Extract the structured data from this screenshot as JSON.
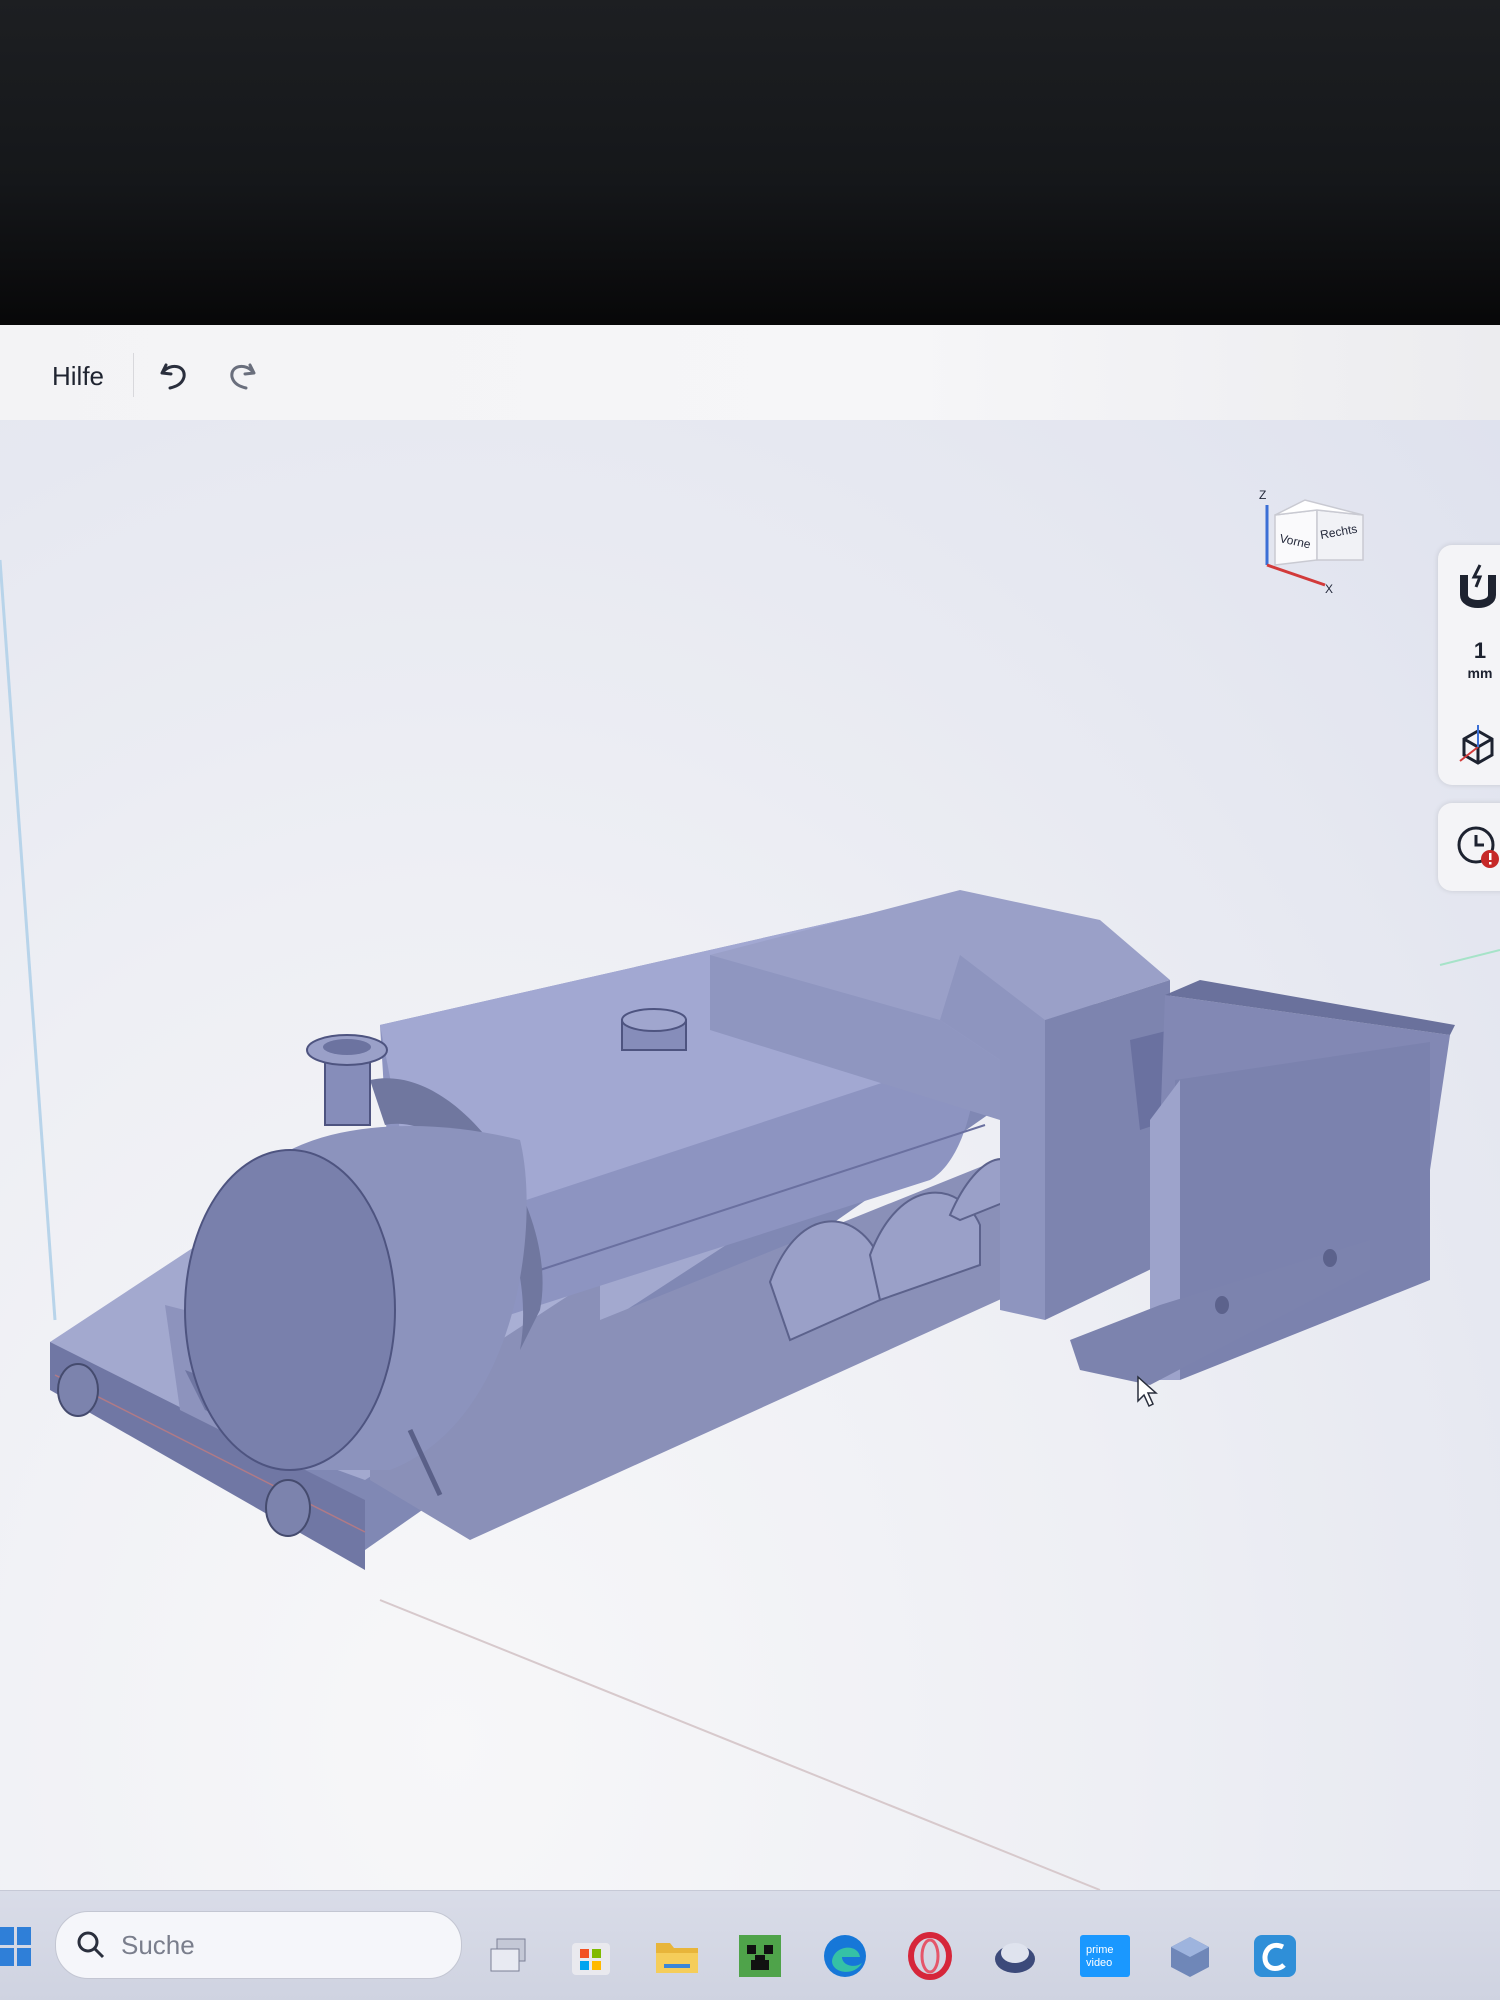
{
  "menubar": {
    "help_label": "Hilfe",
    "undo_icon": "undo-icon",
    "redo_icon": "redo-icon"
  },
  "viewcube": {
    "axis_z": "Z",
    "axis_x": "X",
    "front_label": "Vorne",
    "right_label": "Rechts"
  },
  "right_toolbar": {
    "snap_icon": "magnet-icon",
    "grid_value": "1",
    "grid_unit": "mm",
    "view_icon": "cube-view-icon",
    "history_icon": "clock-warning-icon"
  },
  "taskbar": {
    "search_placeholder": "Suche",
    "icons": [
      "windows-start-icon",
      "search-icon",
      "task-view-icon",
      "store-icon",
      "file-explorer-icon",
      "minecraft-icon",
      "edge-icon",
      "opera-icon",
      "app-icon",
      "prime-video-icon",
      "cad-app-icon",
      "c-app-icon"
    ],
    "prime_label_1": "prime",
    "prime_label_2": "video"
  },
  "colors": {
    "model_fill": "#8a90b8",
    "model_light": "#a5abd0",
    "model_dark": "#5f6590",
    "viewport_bg": "#eeeff4",
    "menubar_bg": "#f3f3f5"
  }
}
